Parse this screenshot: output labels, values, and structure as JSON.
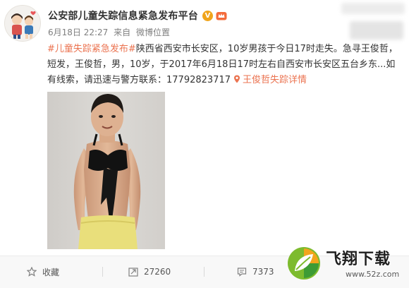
{
  "post": {
    "author_name": "公安部儿童失踪信息紧急发布平台",
    "verified_badge": "V",
    "timestamp": "6月18日 22:27",
    "source_prefix": "来自",
    "source_name": "微博位置",
    "topic": "#儿童失踪紧急发布#",
    "body_text": "陕西省西安市长安区，10岁男孩于今日17时走失。急寻王俊哲，短发，王俊哲，男，10岁，于2017年6月18日17时左右自西安市长安区五台乡东...如有线索，请迅速与警方联系：17792823717",
    "detail_link": "王俊哲失踪详情",
    "icons": {
      "avatar": "avatar-cartoon-icon",
      "verified": "verified-v-icon",
      "member": "member-crown-icon",
      "location": "location-pin-icon"
    }
  },
  "actions": {
    "favorite_label": "收藏",
    "repost_count": "27260",
    "comment_count": "7373",
    "icons": {
      "favorite": "star-icon",
      "repost": "repost-icon",
      "comment": "comment-icon"
    }
  },
  "watermark": {
    "title": "飞翔下载",
    "url": "www.52z.com",
    "icon": "leaf-logo-icon"
  },
  "colors": {
    "link_orange": "#eb7350",
    "text_dark": "#333333",
    "meta_gray": "#808080",
    "badge_gold": "#f0a41b"
  }
}
